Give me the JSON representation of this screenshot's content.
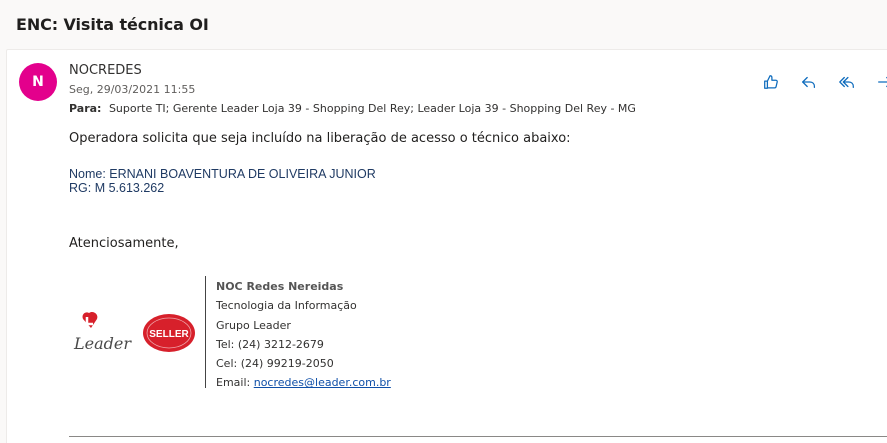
{
  "email": {
    "subject": "ENC: Visita técnica OI",
    "avatar_initial": "N",
    "avatar_color": "#e3008c",
    "sender": "NOCREDES",
    "date": "Seg, 29/03/2021 11:55",
    "to_label": "Para:",
    "to_value": "Suporte TI; Gerente Leader Loja 39 - Shopping Del Rey; Leader Loja 39 - Shopping Del Rey - MG",
    "body_intro": "Operadora solicita que seja incluído na liberação de acesso o técnico abaixo:",
    "tech_name": "Nome: ERNANI BOAVENTURA DE OLIVEIRA JUNIOR",
    "tech_rg": "RG: M 5.613.262",
    "closing": "Atenciosamente,"
  },
  "actions": [
    {
      "name": "like",
      "icon": "thumbs-up-icon"
    },
    {
      "name": "reply",
      "icon": "reply-icon"
    },
    {
      "name": "reply-all",
      "icon": "reply-all-icon"
    },
    {
      "name": "forward",
      "icon": "forward-icon"
    }
  ],
  "signature": {
    "org": "NOC Redes Nereidas",
    "dept": "Tecnologia da Informação",
    "group": "Grupo Leader",
    "tel": "Tel: (24) 3212-2679",
    "cel": "Cel: (24) 99219-2050",
    "email_label": "Email:",
    "email": "nocredes@leader.com.br",
    "logo_leader": "Leader",
    "logo_seller": "SELLER"
  },
  "colors": {
    "accent": "#0f6cbd",
    "leader_red": "#d7202b"
  }
}
